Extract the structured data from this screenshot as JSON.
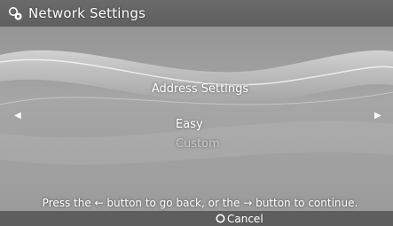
{
  "header": {
    "title": "Network Settings",
    "icon": "network-globe-icon"
  },
  "main": {
    "section_title": "Address Settings",
    "options": [
      {
        "label": "Easy",
        "selected": true
      },
      {
        "label": "Custom",
        "selected": false
      }
    ],
    "nav_left_icon": "left-arrow-icon",
    "nav_right_icon": "right-arrow-icon"
  },
  "footer": {
    "hint": "Press the ← button to go back, or the → button to continue.",
    "cancel_label": "Cancel",
    "cancel_icon": "circle-button-icon"
  },
  "colors": {
    "background": "#9e9e9e",
    "header_bar": "#666666",
    "text": "#ffffff",
    "unselected_text": "#c8c8c8"
  }
}
